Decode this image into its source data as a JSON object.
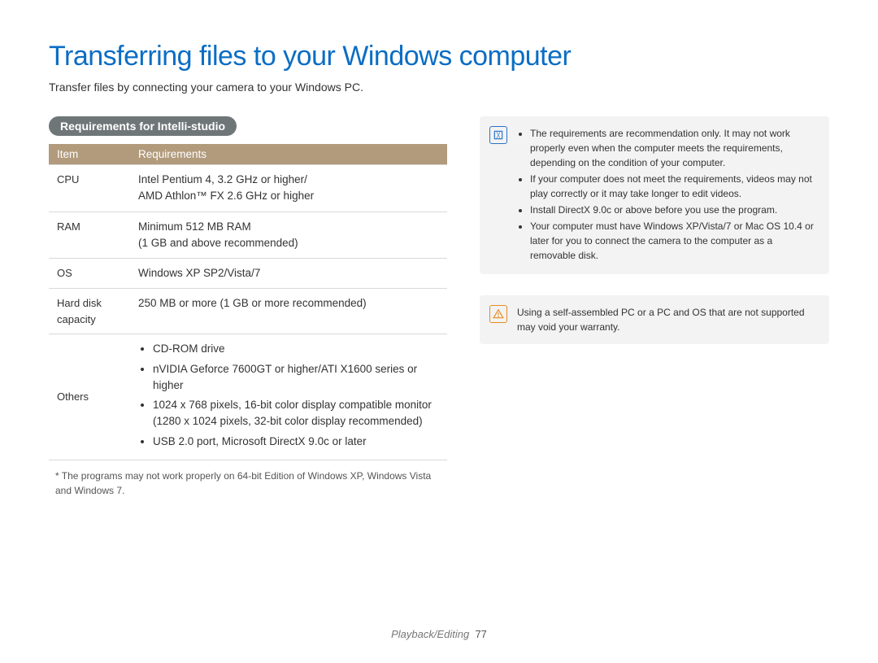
{
  "title": "Transferring files to your Windows computer",
  "intro": "Transfer files by connecting your camera to your Windows PC.",
  "section_pill": "Requirements for Intelli-studio",
  "table": {
    "head_item": "Item",
    "head_req": "Requirements",
    "rows": {
      "cpu": {
        "item": "CPU",
        "req": "Intel Pentium 4, 3.2 GHz or higher/\nAMD Athlon™ FX 2.6 GHz or higher"
      },
      "ram": {
        "item": "RAM",
        "req": "Minimum 512 MB RAM\n(1 GB and above recommended)"
      },
      "os": {
        "item": "OS",
        "req": "Windows XP SP2/Vista/7"
      },
      "hdd": {
        "item": "Hard disk capacity",
        "req": "250 MB or more (1 GB or more recommended)"
      },
      "others": {
        "item": "Others",
        "bullets": [
          "CD-ROM drive",
          "nVIDIA Geforce 7600GT or higher/ATI X1600 series or higher",
          "1024 x 768 pixels, 16-bit color display compatible monitor (1280 x 1024 pixels, 32-bit color display recommended)",
          "USB 2.0 port, Microsoft DirectX 9.0c or later"
        ]
      }
    }
  },
  "footnote": "* The programs may not work properly on 64-bit Edition of Windows XP, Windows Vista and Windows 7.",
  "note_box": {
    "bullets": [
      "The requirements are recommendation only. It may not work properly even when the computer meets the requirements, depending on the condition of your computer.",
      "If your computer does not meet the requirements, videos may not play correctly or it may take longer to edit videos.",
      "Install DirectX 9.0c or above before you use the program.",
      "Your computer must have Windows XP/Vista/7 or Mac OS 10.4 or later for you to connect the camera to the computer as a removable disk."
    ]
  },
  "warn_box": {
    "text": "Using a self-assembled PC or a PC and OS that are not supported may void your warranty."
  },
  "footer": {
    "section": "Playback/Editing",
    "page": "77"
  }
}
